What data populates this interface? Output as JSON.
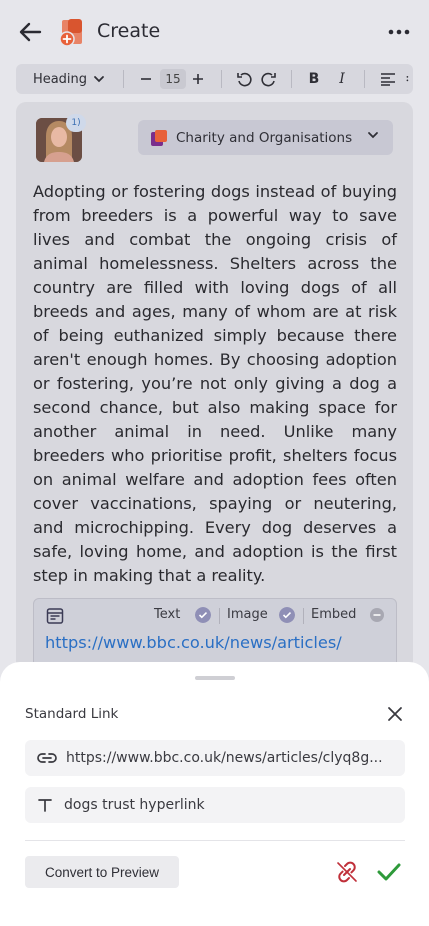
{
  "header": {
    "title": "Create"
  },
  "toolbar": {
    "style": "Heading",
    "font_size": "15",
    "bold": "B",
    "italic": "I"
  },
  "post": {
    "avatar_badge": "1)",
    "category": "Charity and Organisations",
    "body": "Adopting or fostering dogs instead of buying from breeders is a powerful way to save lives and combat the ongoing  crisis of animal homelessness. Shelters across the country are filled  with loving dogs of all breeds and ages, many of whom are at risk of  being euthanized simply because there aren't enough homes. By choosing  adoption or fostering, you’re not only giving a dog a second chance, but  also making space for another animal in need. Unlike many breeders who  prioritise profit, shelters focus on animal welfare and adoption fees  often cover vaccinations, spaying or neutering, and microchipping. Every  dog deserves a safe, loving home, and adoption is the first step in  making that a reality.",
    "embed": {
      "options": [
        "Text",
        "Image",
        "Embed"
      ],
      "url": "https://www.bbc.co.uk/news/articles/"
    }
  },
  "sheet": {
    "title": "Standard Link",
    "link_url": "https://www.bbc.co.uk/news/articles/clyq8g...",
    "link_text": "dogs trust hyperlink",
    "convert_label": "Convert to Preview"
  },
  "colors": {
    "brand": "#e8613a",
    "link": "#2a6fc4",
    "unlink": "#c0303a",
    "confirm": "#2e9a3a"
  }
}
